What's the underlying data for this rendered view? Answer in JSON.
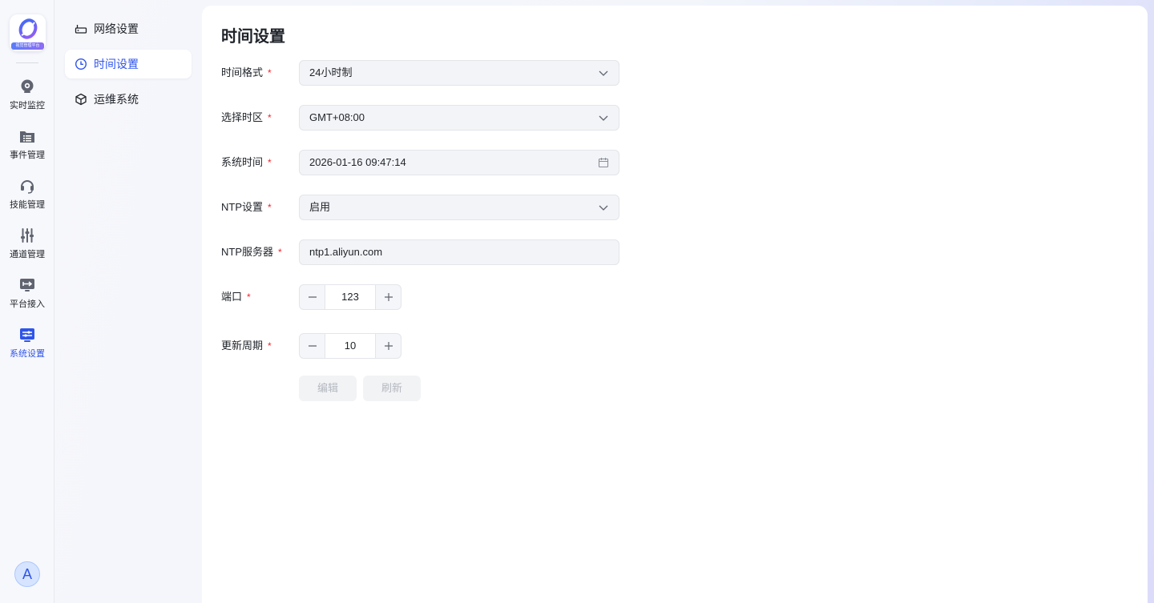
{
  "app": {
    "logo_text": "视觉管理平台"
  },
  "rail": {
    "items": [
      {
        "label": "实时监控",
        "icon": "camera-icon"
      },
      {
        "label": "事件管理",
        "icon": "folder-list-icon"
      },
      {
        "label": "技能管理",
        "icon": "headset-icon"
      },
      {
        "label": "通道管理",
        "icon": "sliders-icon"
      },
      {
        "label": "平台接入",
        "icon": "access-arrows-icon"
      },
      {
        "label": "系统设置",
        "icon": "settings-panel-icon",
        "active": true
      }
    ],
    "avatar": "A"
  },
  "submenu": {
    "items": [
      {
        "label": "网络设置",
        "icon": "router-icon"
      },
      {
        "label": "时间设置",
        "icon": "clock-icon",
        "active": true
      },
      {
        "label": "运维系统",
        "icon": "cube-icon"
      }
    ]
  },
  "page": {
    "title": "时间设置",
    "form": {
      "time_format": {
        "label": "时间格式",
        "value": "24小时制"
      },
      "timezone": {
        "label": "选择时区",
        "value": "GMT+08:00"
      },
      "system_time": {
        "label": "系统时间",
        "value": "2026-01-16 09:47:14"
      },
      "ntp": {
        "label": "NTP设置",
        "value": "启用"
      },
      "ntp_server": {
        "label": "NTP服务器",
        "value": "ntp1.aliyun.com"
      },
      "port": {
        "label": "端口",
        "value": "123"
      },
      "update_period": {
        "label": "更新周期",
        "value": "10"
      },
      "required_mark": "*"
    },
    "buttons": {
      "edit": "编辑",
      "refresh": "刷新"
    }
  },
  "colors": {
    "accent": "#2f54eb",
    "required": "#f5222d",
    "disabled_text": "#b4b8c0"
  }
}
